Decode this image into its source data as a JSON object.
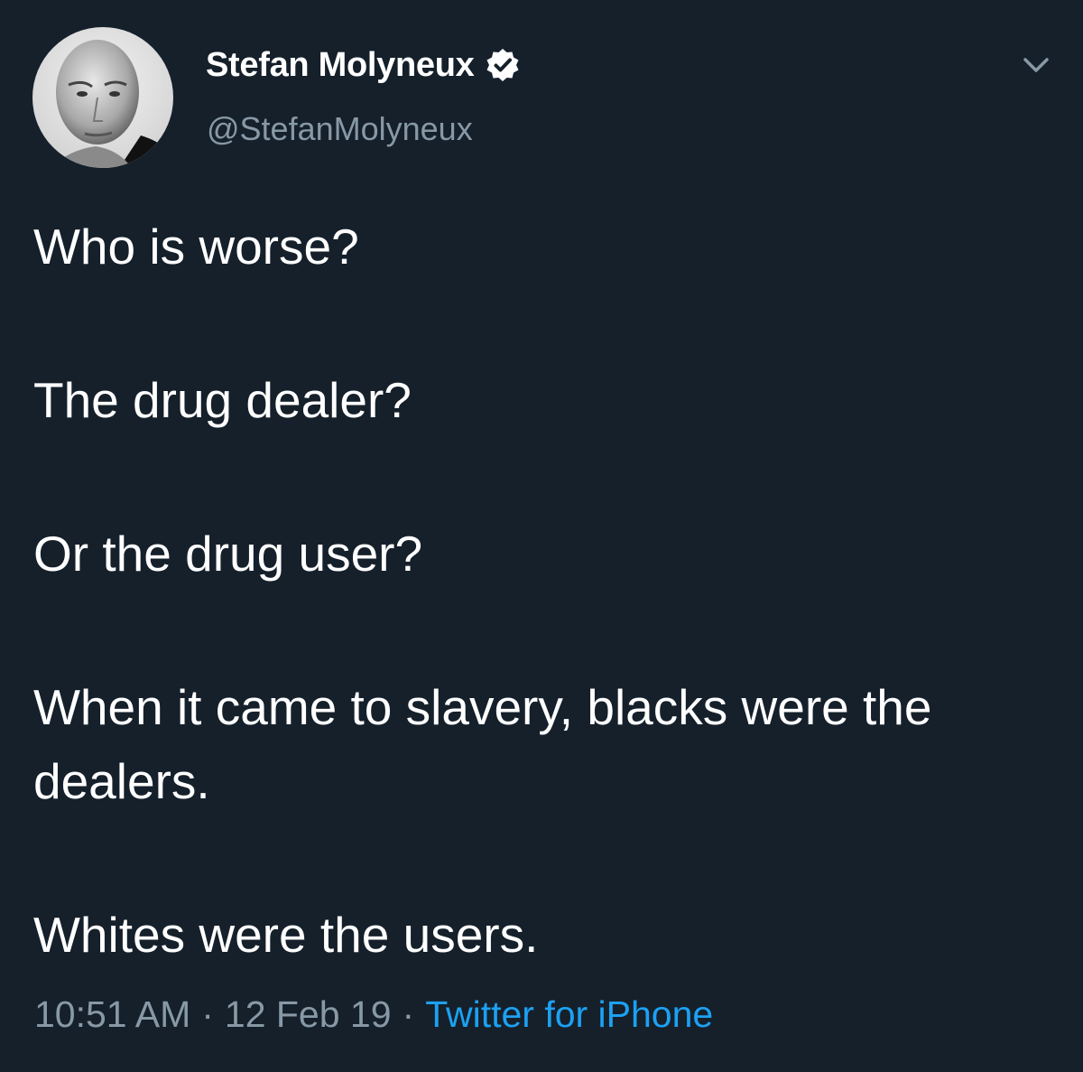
{
  "tweet": {
    "author": {
      "display_name": "Stefan Molyneux",
      "handle": "@StefanMolyneux",
      "verified": true
    },
    "lines": [
      "Who is worse?",
      "The drug dealer?",
      "Or the drug user?",
      "When it came to slavery, blacks were the dealers.",
      "Whites were the users."
    ],
    "time": "10:51 AM",
    "date": "12 Feb 19",
    "separator": "·",
    "source": "Twitter for iPhone"
  },
  "icons": {
    "verified": "verified-badge-icon",
    "menu": "chevron-down-icon"
  },
  "colors": {
    "background": "#15202b",
    "secondary_text": "#8899a6",
    "accent": "#1da1f2"
  }
}
